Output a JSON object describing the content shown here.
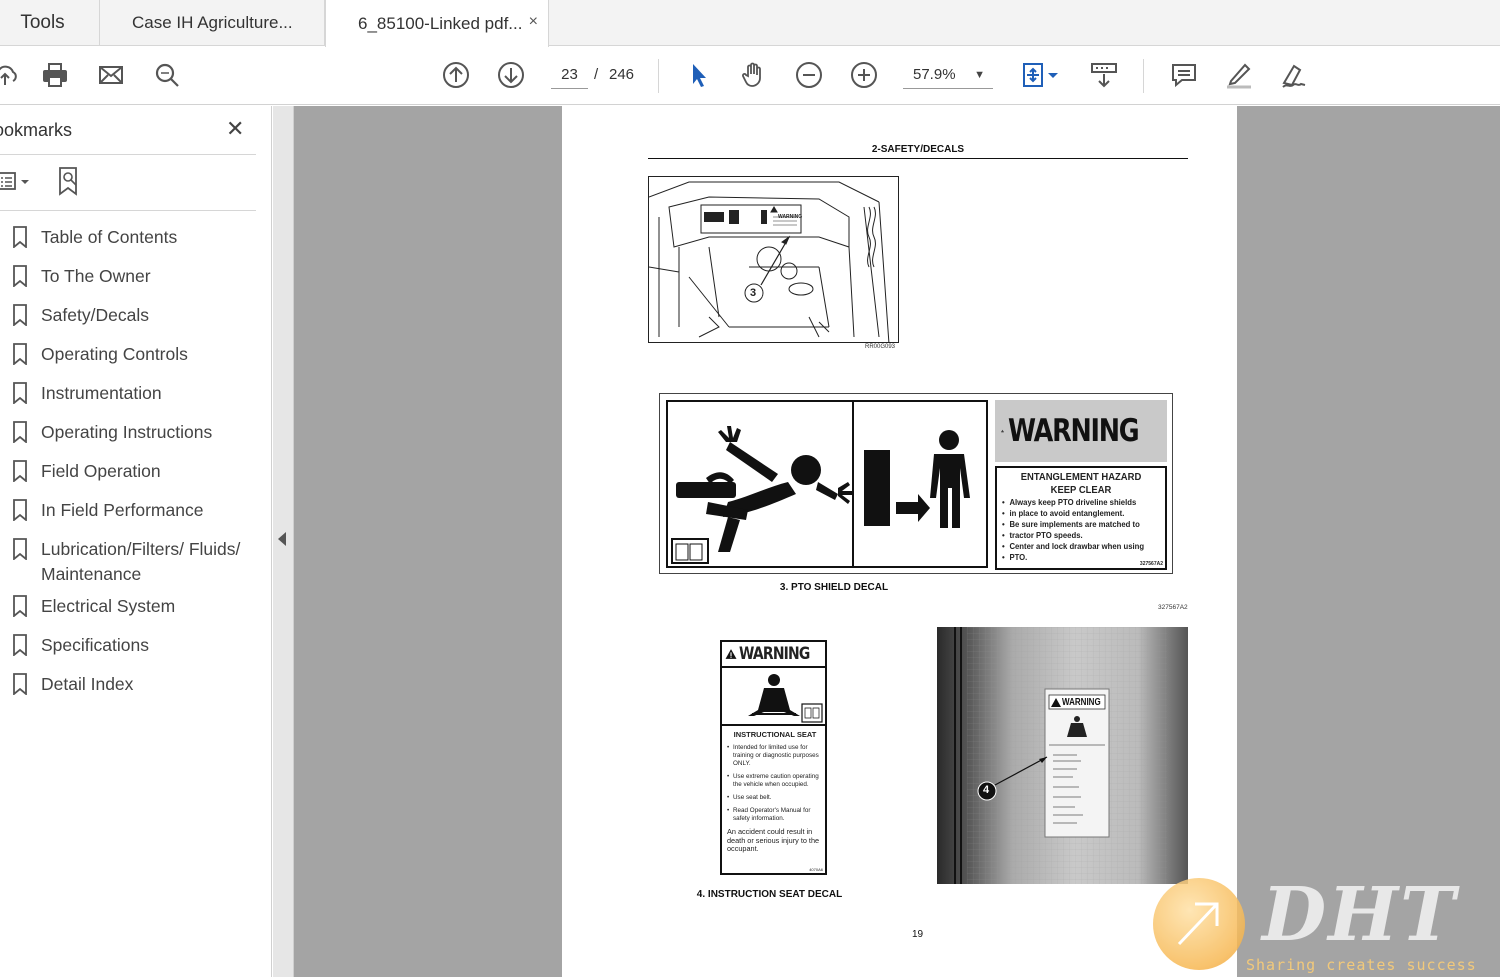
{
  "tabs": {
    "tools": "Tools",
    "doc1": "Case IH Agriculture...",
    "doc2": "6_85100-Linked pdf...",
    "close_glyph": "×"
  },
  "toolbar": {
    "current_page": "23",
    "page_sep": "/",
    "total_pages": "246",
    "zoom": "57.9%"
  },
  "sidebar": {
    "title": "ookmarks",
    "close_glyph": "✕",
    "bookmarks": [
      "Table of Contents",
      "To The Owner",
      "Safety/Decals",
      "Operating Controls",
      "Instrumentation",
      "Operating Instructions",
      "Field Operation",
      "In Field Performance",
      "Lubrication/Filters/ Fluids/ Maintenance",
      "Electrical System",
      "Specifications",
      "Detail Index"
    ]
  },
  "document": {
    "header": "2-SAFETY/DECALS",
    "fig1_code": "RR00G093",
    "fig1_callout": "3",
    "fig1_mini_warning": "WARNING",
    "decal3": {
      "warning": "WARNING",
      "hazard_title": "ENTANGLEMENT HAZARD",
      "hazard_sub": "KEEP CLEAR",
      "items": [
        "Always keep PTO driveline shields",
        "in place to avoid entanglement.",
        "Be sure implements are matched to",
        "tractor PTO speeds.",
        "Center and lock drawbar when using",
        "PTO."
      ],
      "code": "327567A2"
    },
    "caption3": "3. PTO SHIELD DECAL",
    "code3b": "327567A2",
    "decal4": {
      "warning": "WARNING",
      "heading": "INSTRUCTIONAL SEAT",
      "items": [
        "Intended for limited use for training or diagnostic purposes ONLY.",
        "Use extreme caution operating the vehicle when occupied.",
        "Use seat belt.",
        "Read Operator's Manual for safety information."
      ],
      "footer": "An accident could result in death or serious injury to the occupant.",
      "code": "4070A6"
    },
    "caption4": "4. INSTRUCTION SEAT DECAL",
    "photo_callout": "4",
    "photo_warning": "WARNING",
    "page_number": "19"
  },
  "watermark": {
    "brand": "DHT",
    "tagline": "Sharing creates success"
  }
}
